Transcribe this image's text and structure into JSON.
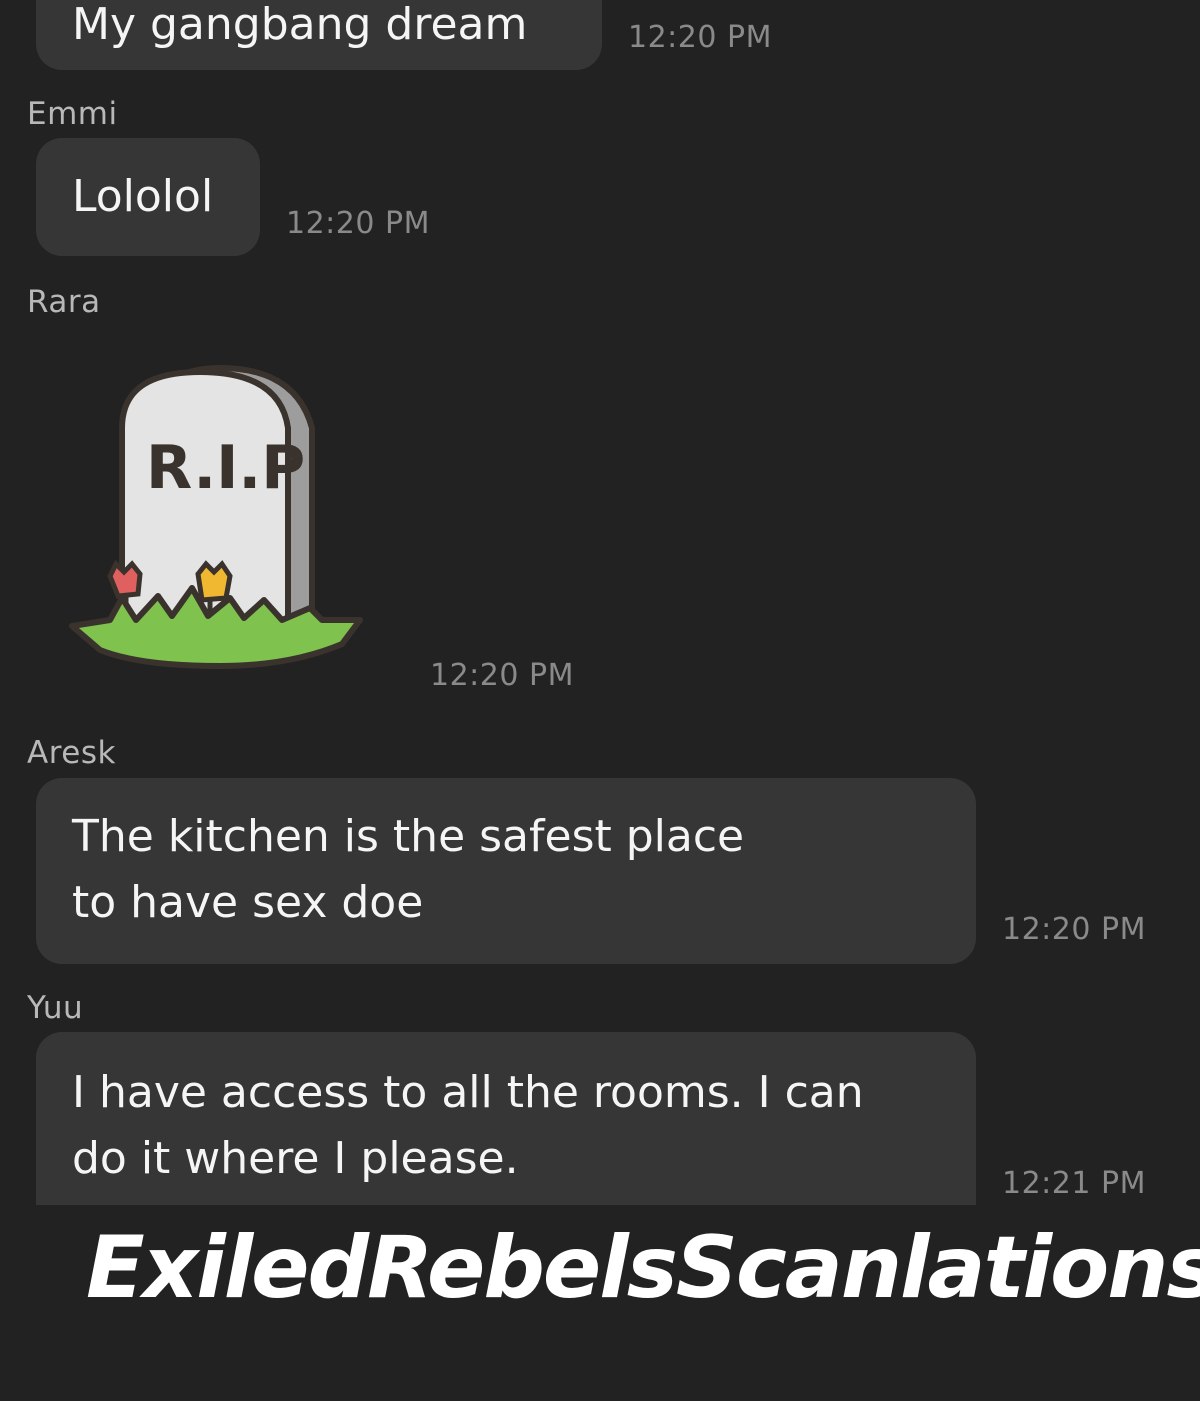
{
  "messages": [
    {
      "sender": "",
      "text": "My gangbang dream",
      "time": "12:20 PM"
    },
    {
      "sender": "Emmi",
      "text": "Lololol",
      "time": "12:20 PM"
    },
    {
      "sender": "Rara",
      "sticker_text": "R.I.P",
      "sticker_icon": "tombstone-rip-sticker",
      "time": "12:20 PM"
    },
    {
      "sender": "Aresk",
      "text_lines": [
        "The kitchen is the safest place",
        "to have sex doe"
      ],
      "time": "12:20 PM"
    },
    {
      "sender": "Yuu",
      "text_lines": [
        "I have access to all the rooms. I can",
        "do it where I please."
      ],
      "time": "12:21 PM"
    }
  ],
  "watermark": "ExiledRebelsScanlations",
  "colors": {
    "background": "#222222",
    "bubble": "#363636",
    "sender": "#b8b8b8",
    "time": "#8a8a8a",
    "text": "#f5f5f5"
  }
}
